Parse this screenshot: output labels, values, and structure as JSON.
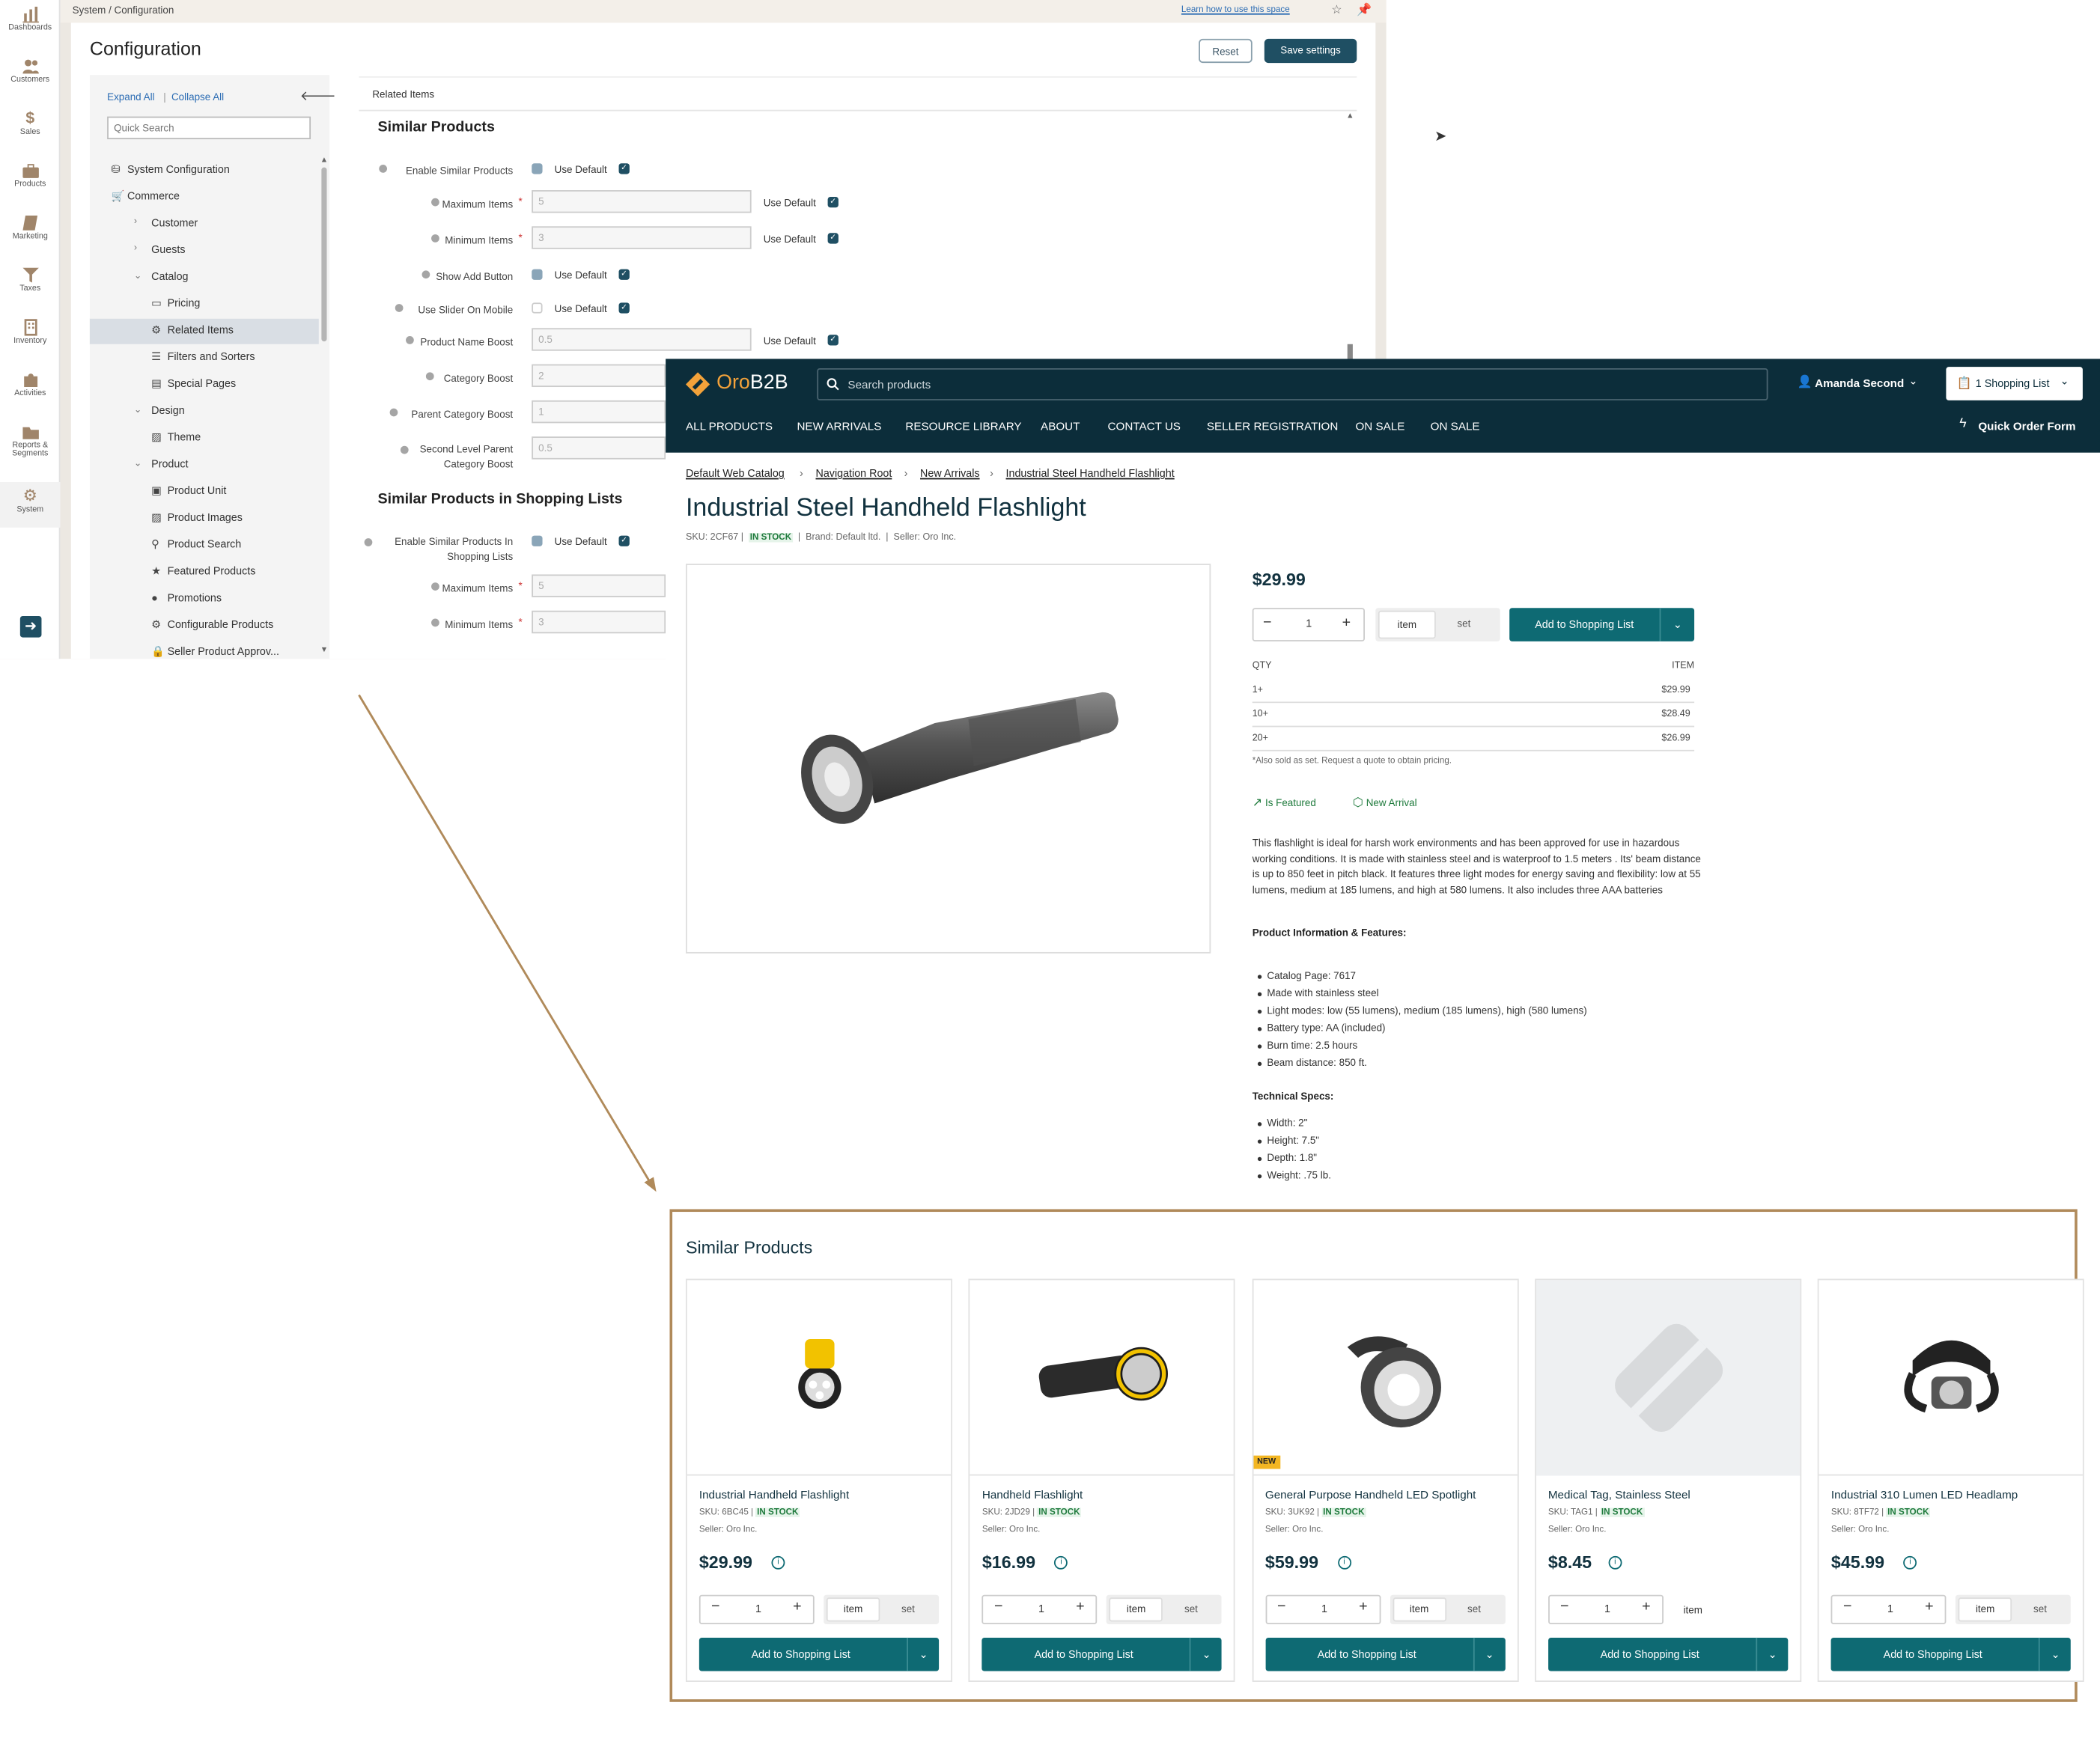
{
  "admin": {
    "breadcrumb": "System / Configuration",
    "learn_link": "Learn how to use this space",
    "page_title": "Configuration",
    "reset_label": "Reset",
    "save_label": "Save settings",
    "nav": [
      {
        "label": "Dashboards",
        "icon": "bar-chart-icon"
      },
      {
        "label": "Customers",
        "icon": "users-icon"
      },
      {
        "label": "Sales",
        "icon": "dollar-icon"
      },
      {
        "label": "Products",
        "icon": "briefcase-icon"
      },
      {
        "label": "Marketing",
        "icon": "book-icon"
      },
      {
        "label": "Taxes",
        "icon": "filter-icon"
      },
      {
        "label": "Inventory",
        "icon": "building-icon"
      },
      {
        "label": "Activities",
        "icon": "puzzle-icon"
      },
      {
        "label": "Reports &",
        "label2": "Segments",
        "icon": "folder-icon"
      },
      {
        "label": "System",
        "icon": "gear-icon"
      }
    ],
    "tree": {
      "expand_all": "Expand All",
      "collapse_all": "Collapse All",
      "search_placeholder": "Quick Search",
      "items": [
        "System Configuration",
        "Commerce",
        "Customer",
        "Guests",
        "Catalog",
        "Pricing",
        "Related Items",
        "Filters and Sorters",
        "Special Pages",
        "Design",
        "Theme",
        "Product",
        "Product Unit",
        "Product Images",
        "Product Search",
        "Featured Products",
        "Promotions",
        "Configurable Products",
        "Seller Product Approv..."
      ]
    },
    "panel_title": "Related Items",
    "section1": "Similar Products",
    "section2": "Similar Products in Shopping Lists",
    "use_default": "Use Default",
    "fields": [
      {
        "label": "Enable Similar Products"
      },
      {
        "label": "Maximum Items",
        "value": "5"
      },
      {
        "label": "Minimum Items",
        "value": "3"
      },
      {
        "label": "Show Add Button"
      },
      {
        "label": "Use Slider On Mobile"
      },
      {
        "label": "Product Name Boost",
        "value": "0.5"
      },
      {
        "label": "Category Boost",
        "value": "2"
      },
      {
        "label": "Parent Category Boost",
        "value": "1"
      },
      {
        "label": "Second Level Parent",
        "label2": "Category Boost",
        "value": "0.5"
      },
      {
        "label": "Enable Similar Products In",
        "label2": "Shopping Lists"
      },
      {
        "label": "Maximum Items",
        "value": "5"
      },
      {
        "label": "Minimum Items",
        "value": "3"
      }
    ]
  },
  "store": {
    "logo_a": "Oro",
    "logo_b": "B2B",
    "search_placeholder": "Search products",
    "user": "Amanda Second",
    "shopping_list_btn": "1 Shopping List",
    "nav": [
      "ALL PRODUCTS",
      "NEW ARRIVALS",
      "RESOURCE LIBRARY",
      "ABOUT",
      "CONTACT US",
      "SELLER REGISTRATION",
      "ON SALE",
      "ON SALE"
    ],
    "quick_order": "Quick Order Form",
    "breadcrumbs": [
      "Default Web Catalog",
      "Navigation Root",
      "New Arrivals",
      "Industrial Steel Handheld Flashlight"
    ],
    "product": {
      "title": "Industrial Steel Handheld Flashlight",
      "sku": "SKU: 2CF67",
      "stock": "IN STOCK",
      "brand": "Brand: Default ltd.",
      "seller": "Seller: Oro Inc.",
      "price": "$29.99",
      "qty": "1",
      "unit_item": "item",
      "unit_set": "set",
      "add_label": "Add to Shopping List",
      "tier_qty_header": "QTY",
      "tier_item_header": "ITEM",
      "tiers": [
        {
          "qty": "1+",
          "price": "$29.99"
        },
        {
          "qty": "10+",
          "price": "$28.49"
        },
        {
          "qty": "20+",
          "price": "$26.99"
        }
      ],
      "note": "*Also sold as set. Request a quote to obtain pricing.",
      "badge_featured": "Is Featured",
      "badge_new": "New Arrival",
      "description": "This flashlight is ideal for harsh work environments and has been approved for use in hazardous working conditions. It is made with stainless steel and is waterproof to 1.5 meters . Its' beam distance is up to 850 feet in pitch black. It features three light modes for energy saving and flexibility: low at 55 lumens, medium at 185 lumens, and high at 580 lumens. It also includes three AAA batteries",
      "info_heading": "Product Information & Features:",
      "features": [
        "Catalog Page: 7617",
        "Made with stainless steel",
        "Light modes: low (55 lumens), medium (185 lumens), high (580 lumens)",
        "Battery type: AA (included)",
        "Burn time: 2.5 hours",
        "Beam distance: 850 ft."
      ],
      "specs_heading": "Technical Specs:",
      "specs": [
        "Width: 2\"",
        "Height: 7.5\"",
        "Depth: 1.8\"",
        "Weight: .75 lb."
      ]
    },
    "similar_title": "Similar Products",
    "similar": [
      {
        "name": "Industrial Handheld Flashlight",
        "sku": "SKU: 6BC45 |",
        "stock": "IN STOCK",
        "seller": "Seller: Oro Inc.",
        "price": "$29.99",
        "qty": "1",
        "unit_item": "item",
        "unit_set": "set",
        "add": "Add to Shopping List"
      },
      {
        "name": "Handheld Flashlight",
        "sku": "SKU: 2JD29 |",
        "stock": "IN STOCK",
        "seller": "Seller: Oro Inc.",
        "price": "$16.99",
        "qty": "1",
        "unit_item": "item",
        "unit_set": "set",
        "add": "Add to Shopping List"
      },
      {
        "name": "General Purpose Handheld LED Spotlight",
        "sku": "SKU: 3UK92 |",
        "stock": "IN STOCK",
        "seller": "Seller: Oro Inc.",
        "price": "$59.99",
        "qty": "1",
        "unit_item": "item",
        "unit_set": "set",
        "add": "Add to Shopping List",
        "badge": "NEW"
      },
      {
        "name": "Medical Tag, Stainless Steel",
        "sku": "SKU: TAG1 |",
        "stock": "IN STOCK",
        "seller": "Seller: Oro Inc.",
        "price": "$8.45",
        "qty": "1",
        "unit_item": "item",
        "add": "Add to Shopping List"
      },
      {
        "name": "Industrial 310 Lumen LED Headlamp",
        "sku": "SKU: 8TF72 |",
        "stock": "IN STOCK",
        "seller": "Seller: Oro Inc.",
        "price": "$45.99",
        "qty": "1",
        "unit_item": "item",
        "unit_set": "set",
        "add": "Add to Shopping List"
      }
    ]
  },
  "colors": {
    "accent": "#0e6a73",
    "header": "#0c2d3a",
    "admin_primary": "#1f4f63",
    "callout": "#b08a5a"
  }
}
